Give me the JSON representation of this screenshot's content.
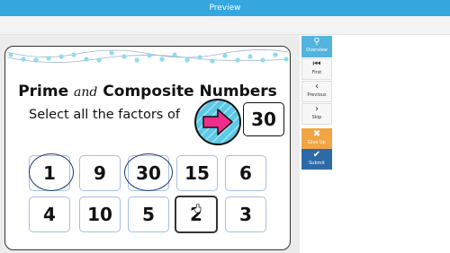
{
  "header": {
    "title": "Preview"
  },
  "activity": {
    "title_part1": "Prime",
    "title_and": "and",
    "title_part2": "Composite Numbers",
    "prompt": "Select all the factors of",
    "target_number": "30",
    "tiles": [
      "1",
      "9",
      "30",
      "15",
      "6",
      "4",
      "10",
      "5",
      "2",
      "3"
    ]
  },
  "sidebar": {
    "overview": "Overview",
    "first": "First",
    "previous": "Previous",
    "skip": "Skip",
    "give_up": "Give Up",
    "submit": "Submit"
  },
  "colors": {
    "header": "#36a7de",
    "accent_orange": "#f1a545",
    "accent_blue": "#2e6aa8",
    "arrow": "#f02d8c"
  }
}
